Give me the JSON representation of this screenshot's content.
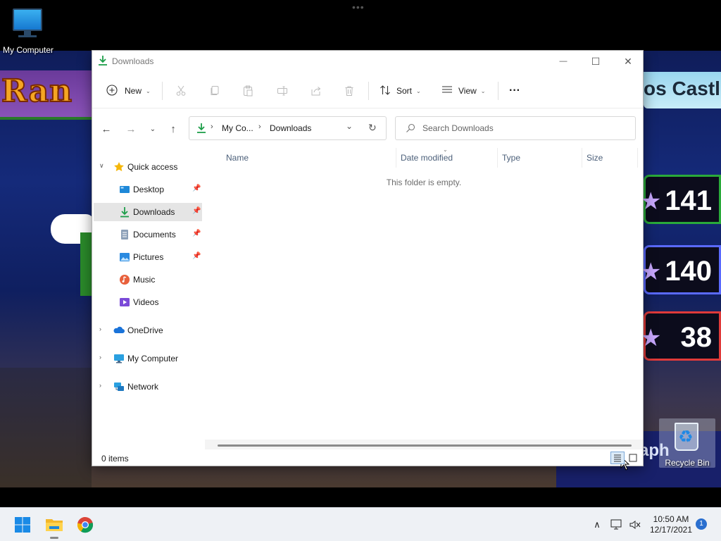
{
  "desktop": {
    "icons": [
      {
        "label": "My Computer",
        "icon": "monitor-icon"
      },
      {
        "label": "Recycle Bin",
        "icon": "recycle-bin-icon"
      }
    ],
    "wallpaper_text": {
      "left_banner": "Ran",
      "right_banner": "os Castle",
      "scores": [
        "141",
        "140",
        "38"
      ],
      "graph_label": "aph"
    }
  },
  "window": {
    "title": "Downloads",
    "controls": {
      "minimize": "—",
      "maximize": "☐",
      "close": "✕"
    },
    "commandbar": {
      "new_label": "New",
      "sort_label": "Sort",
      "view_label": "View",
      "more_label": "···",
      "icons": [
        "cut-icon",
        "copy-icon",
        "paste-icon",
        "rename-icon",
        "share-icon",
        "delete-icon"
      ]
    },
    "address": {
      "crumbs": [
        "My Co...",
        "Downloads"
      ],
      "search_placeholder": "Search Downloads"
    },
    "nav": {
      "quick_access": "Quick access",
      "pinned": [
        {
          "label": "Desktop",
          "pinned": true
        },
        {
          "label": "Downloads",
          "pinned": true,
          "selected": true
        },
        {
          "label": "Documents",
          "pinned": true
        },
        {
          "label": "Pictures",
          "pinned": true
        },
        {
          "label": "Music",
          "pinned": false
        },
        {
          "label": "Videos",
          "pinned": false
        }
      ],
      "roots": [
        "OneDrive",
        "My Computer",
        "Network"
      ]
    },
    "columns": [
      "Name",
      "Date modified",
      "Type",
      "Size"
    ],
    "empty_message": "This folder is empty.",
    "status": {
      "item_count": "0 items"
    }
  },
  "taskbar": {
    "apps": [
      "start-icon",
      "file-explorer-icon",
      "chrome-icon"
    ],
    "clock": {
      "time": "10:50 AM",
      "date": "12/17/2021"
    },
    "notification_count": "1"
  },
  "colors": {
    "accent": "#0078d4",
    "download_green": "#1e9e4a",
    "selected_nav": "#e5e5e5"
  }
}
